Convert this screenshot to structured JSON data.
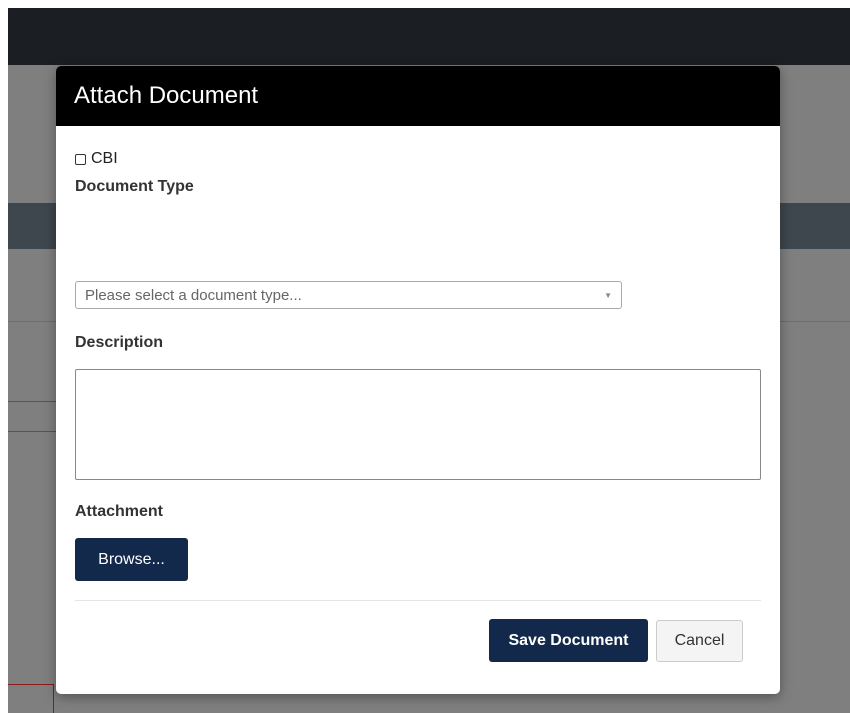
{
  "modal": {
    "title": "Attach Document",
    "cbi_label": "CBI",
    "document_type_label": "Document Type",
    "document_type_placeholder": "Please select a document type...",
    "description_label": "Description",
    "description_value": "",
    "attachment_label": "Attachment",
    "browse_label": "Browse...",
    "save_label": "Save Document",
    "cancel_label": "Cancel"
  },
  "icons": {
    "checkbox": "checkbox-unchecked-icon",
    "select_arrow": "triangle-down-icon"
  },
  "colors": {
    "header_bg": "#000000",
    "primary_button": "#13294b",
    "overlay": "#7f7f7f"
  }
}
